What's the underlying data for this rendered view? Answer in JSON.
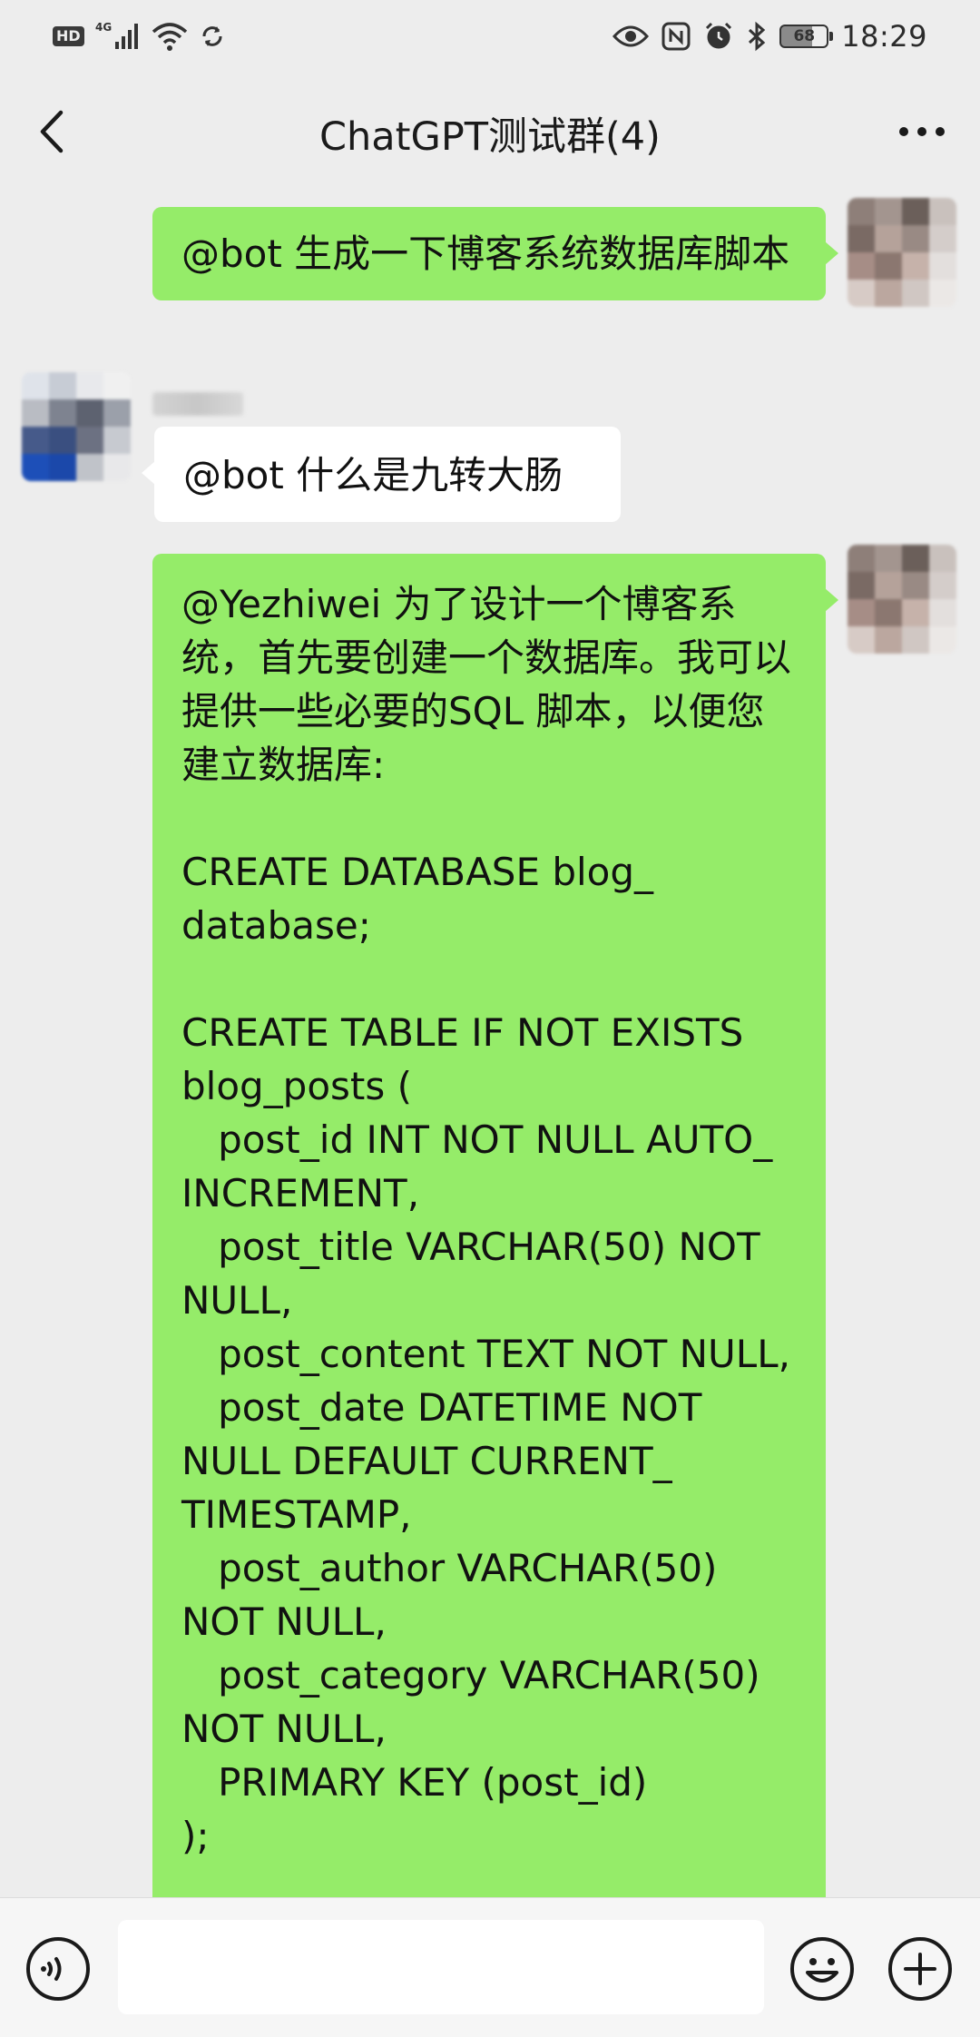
{
  "status_bar": {
    "hd_label": "HD",
    "network_label": "4G",
    "battery_level": "68",
    "time": "18:29",
    "icons": [
      "hd-icon",
      "signal-icon",
      "wifi-icon",
      "sync-icon",
      "eye-icon",
      "nfc-icon",
      "alarm-icon",
      "bluetooth-icon",
      "battery-icon"
    ]
  },
  "header": {
    "title": "ChatGPT测试群(4)",
    "back_icon": "chevron-left-icon",
    "more_icon": "more-dots-icon"
  },
  "messages": [
    {
      "side": "right",
      "text": "@bot 生成一下博客系统数据库脚本"
    },
    {
      "side": "left",
      "text": "@bot 什么是九转大肠"
    },
    {
      "side": "right",
      "text": "@Yezhiwei 为了设计一个博客系统，首先要创建一个数据库。我可以提供一些必要的SQL 脚本，以便您建立数据库:\n\nCREATE DATABASE blog_\ndatabase;\n\nCREATE TABLE IF NOT EXISTS\nblog_posts (\n   post_id INT NOT NULL AUTO_\nINCREMENT,\n   post_title VARCHAR(50) NOT\nNULL,\n   post_content TEXT NOT NULL,\n   post_date DATETIME NOT\nNULL DEFAULT CURRENT_\nTIMESTAMP,\n   post_author VARCHAR(50)\nNOT NULL,\n   post_category VARCHAR(50)\nNOT NULL,\n   PRIMARY KEY (post_id)\n);"
    }
  ],
  "input_bar": {
    "voice_icon": "voice-icon",
    "emoji_icon": "emoji-icon",
    "plus_icon": "plus-icon",
    "input_value": ""
  },
  "colors": {
    "background": "#ededed",
    "my_bubble": "#95ec69",
    "other_bubble": "#ffffff",
    "input_bar": "#f6f6f6"
  }
}
